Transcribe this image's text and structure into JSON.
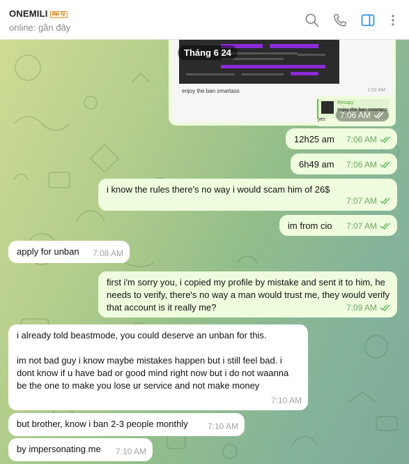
{
  "header": {
    "title": "ONEMILI",
    "title_badge": "đại lý",
    "status": "online: gần đây",
    "icons": [
      "search-icon",
      "phone-icon",
      "sidebar-toggle-icon",
      "more-vertical-icon"
    ]
  },
  "media": {
    "date_label": "Tháng 6 24",
    "caption": "enjoy the ban smartass",
    "inner_time": "1:52 AM"
  },
  "reply": {
    "quoted_name": "Resspy",
    "quoted_text": "enjoy the ban smartass",
    "text": "yes",
    "time": "7:06 AM"
  },
  "messages": [
    {
      "dir": "out",
      "text": "12h25 am",
      "time": "7:06 AM"
    },
    {
      "dir": "out",
      "text": "6h49 am",
      "time": "7:06 AM"
    },
    {
      "dir": "out",
      "text": "i know the rules there's no way i would scam him of 26$",
      "time": "7:07 AM"
    },
    {
      "dir": "out",
      "text": "im from cio",
      "time": "7:07 AM"
    },
    {
      "dir": "in",
      "text": "apply for unban",
      "time": "7:08 AM"
    },
    {
      "dir": "out",
      "text": "first i'm sorry you, i copied my profile by mistake and sent it to him, he needs to verify, there's no way a man would trust me, they would verify that account is it really me?",
      "time": "7:09 AM"
    },
    {
      "dir": "in",
      "text": "i already told beastmode, you could deserve an unban for this.\n\nim not bad guy i know maybe mistakes happen but i still feel bad. i dont know if u have bad or good mind right now but i do not waanna be the one to make you lose ur service and not make money",
      "time": "7:10 AM"
    },
    {
      "dir": "in",
      "text": "but brother, know i ban 2-3 people monthly",
      "time": "7:10 AM"
    },
    {
      "dir": "in",
      "text": "by impersonating me",
      "time": "7:10 AM"
    }
  ],
  "colors": {
    "outgoing_bubble": "#effdde",
    "incoming_bubble": "#ffffff",
    "tick_green": "#5fb65a",
    "accent_blue": "#3390ec"
  }
}
